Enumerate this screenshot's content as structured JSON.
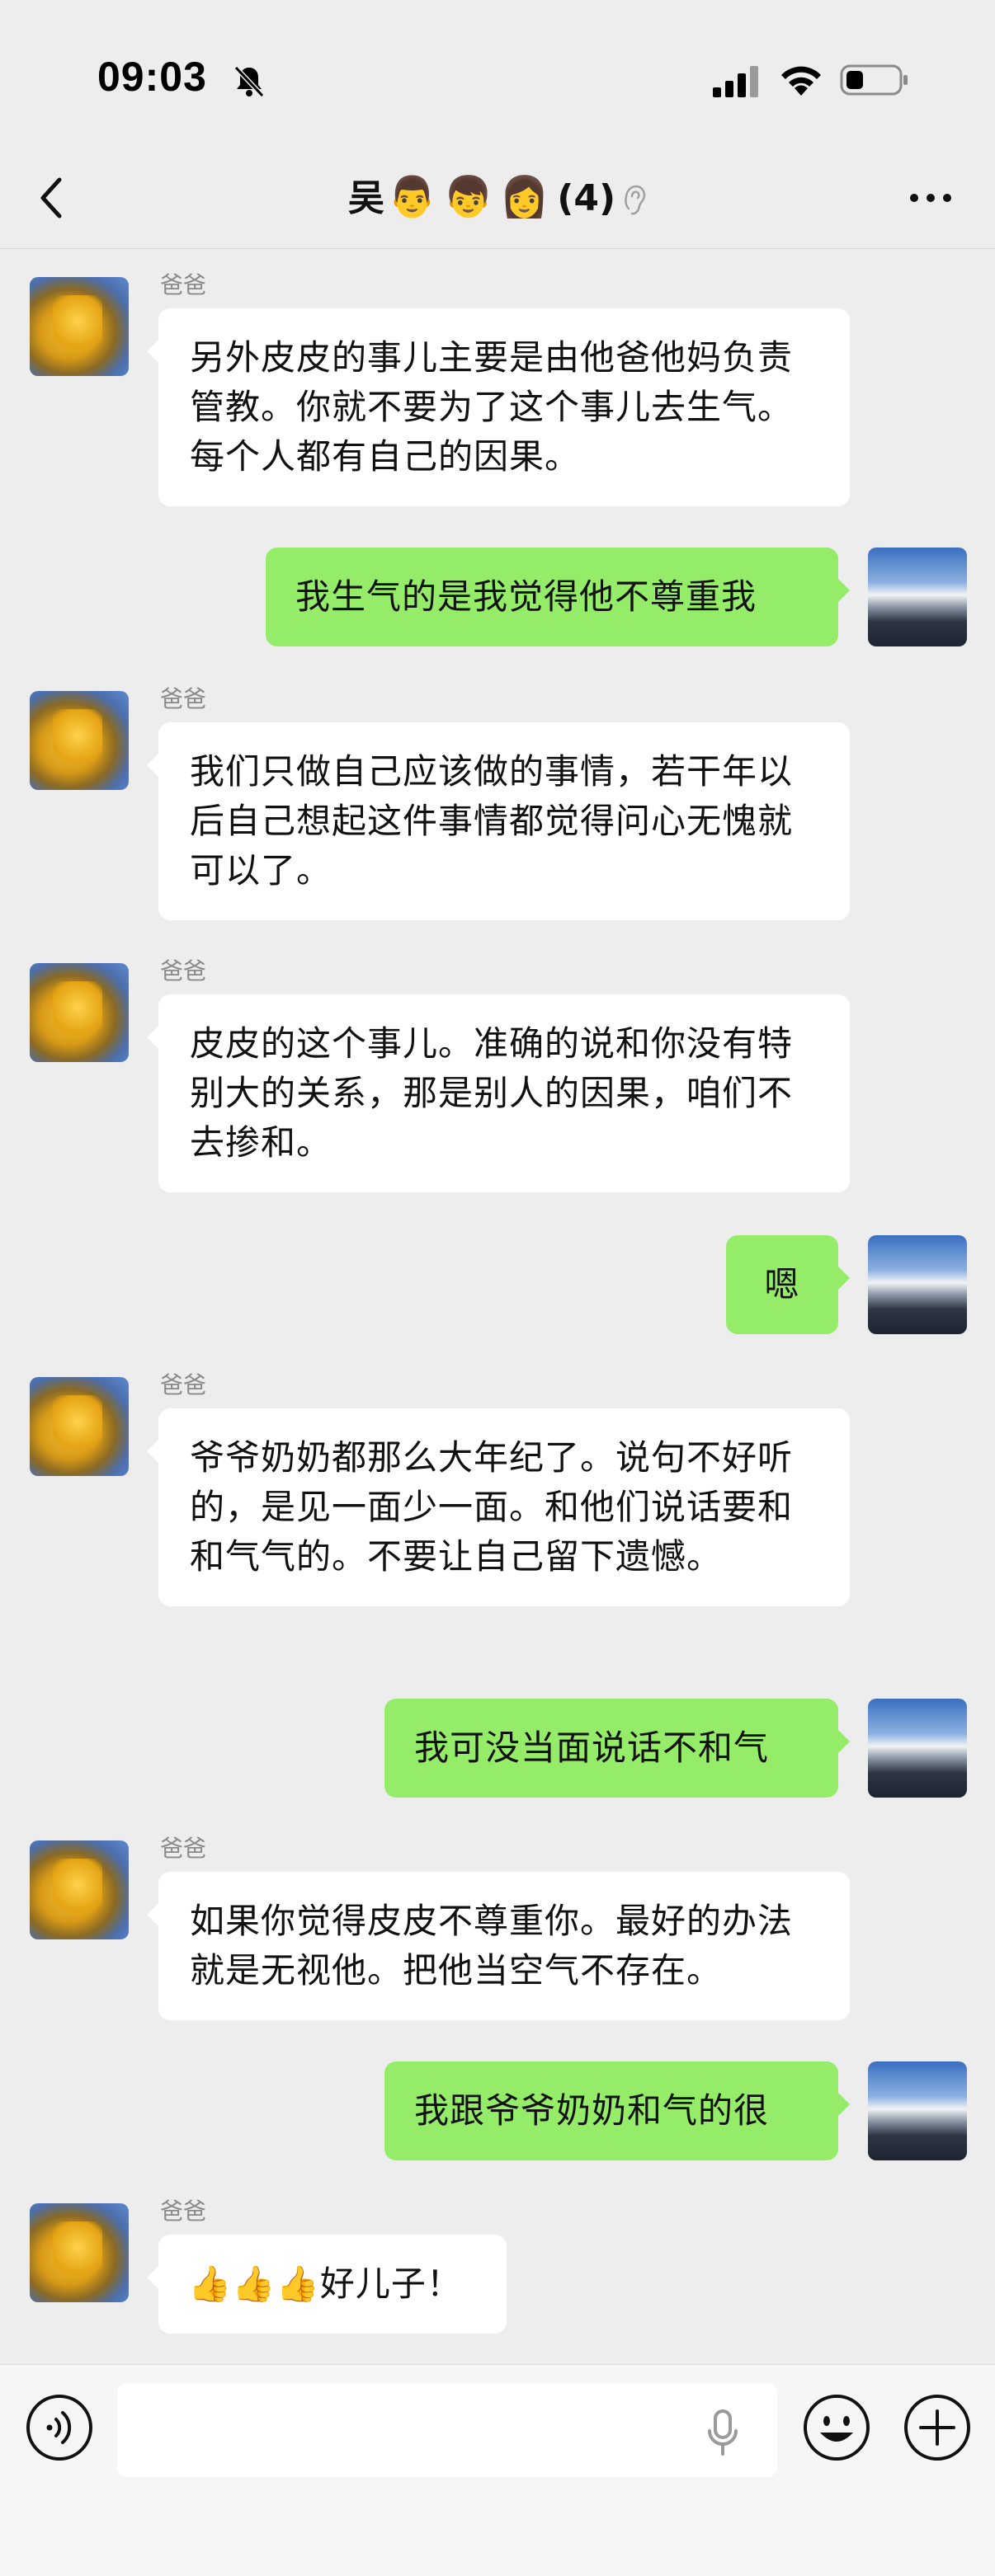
{
  "status_bar": {
    "time": "09:03",
    "icons": [
      "bell-off-icon",
      "cellular-signal-icon",
      "wifi-icon",
      "battery-icon"
    ]
  },
  "nav": {
    "back_icon": "chevron-left-icon",
    "title_name": "吴",
    "title_emojis": [
      "👨",
      "👦",
      "👩"
    ],
    "member_count": "(4)",
    "ear_icon": "ear-icon",
    "more_icon": "more-dots-icon"
  },
  "messages": [
    {
      "side": "left",
      "sender": "爸爸",
      "text": "另外皮皮的事儿主要是由他爸他妈负责管教。你就不要为了这个事儿去生气。每个人都有自己的因果。"
    },
    {
      "side": "right",
      "text": "我生气的是我觉得他不尊重我"
    },
    {
      "side": "left",
      "sender": "爸爸",
      "text": "我们只做自己应该做的事情，若干年以后自己想起这件事情都觉得问心无愧就可以了。"
    },
    {
      "side": "left",
      "sender": "爸爸",
      "text": "皮皮的这个事儿。准确的说和你没有特别大的关系，那是别人的因果，咱们不去掺和。"
    },
    {
      "side": "right",
      "text": "嗯"
    },
    {
      "side": "left",
      "sender": "爸爸",
      "text": "爷爷奶奶都那么大年纪了。说句不好听的，是见一面少一面。和他们说话要和和气气的。不要让自己留下遗憾。"
    },
    {
      "side": "right",
      "text": "我可没当面说话不和气"
    },
    {
      "side": "left",
      "sender": "爸爸",
      "text": "如果你觉得皮皮不尊重你。最好的办法就是无视他。把他当空气不存在。"
    },
    {
      "side": "right",
      "text": "我跟爷爷奶奶和气的很"
    },
    {
      "side": "left",
      "sender": "爸爸",
      "text": "👍👍👍好儿子！"
    }
  ],
  "input_bar": {
    "voice_icon": "voice-input-icon",
    "input_value": "",
    "mic_icon": "microphone-icon",
    "emoji_icon": "emoji-icon",
    "plus_icon": "plus-icon"
  },
  "colors": {
    "background": "#ededed",
    "bubble_self": "#95ec69",
    "bubble_other": "#ffffff",
    "sender_name": "#8a8a8a"
  }
}
